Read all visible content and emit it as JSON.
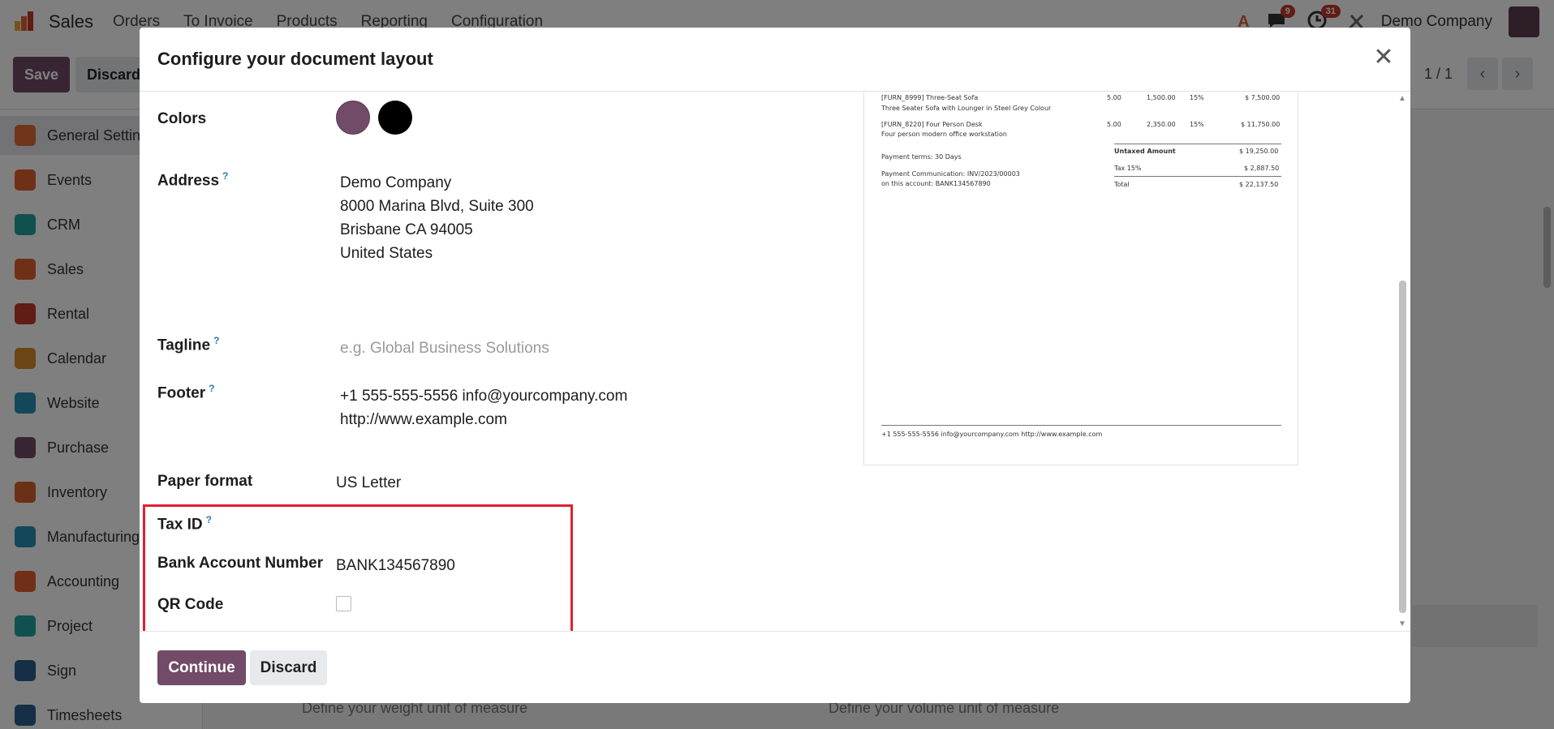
{
  "app": {
    "name": "Sales"
  },
  "topnav": [
    "Orders",
    "To Invoice",
    "Products",
    "Reporting",
    "Configuration"
  ],
  "topright": {
    "messages_count": "9",
    "activities_count": "31",
    "company": "Demo Company"
  },
  "control": {
    "save_label": "Save",
    "discard_label": "Discard",
    "pager": "1 / 1"
  },
  "sidebar": {
    "items": [
      {
        "label": "General Settings",
        "color": "#e06b35"
      },
      {
        "label": "Events",
        "color": "#e0602e"
      },
      {
        "label": "CRM",
        "color": "#20a3a0"
      },
      {
        "label": "Sales",
        "color": "#e0602e"
      },
      {
        "label": "Rental",
        "color": "#c0392b"
      },
      {
        "label": "Calendar",
        "color": "#d98a2b"
      },
      {
        "label": "Website",
        "color": "#2a8fb5"
      },
      {
        "label": "Purchase",
        "color": "#714b67"
      },
      {
        "label": "Inventory",
        "color": "#d9612e"
      },
      {
        "label": "Manufacturing",
        "color": "#2a8fb5"
      },
      {
        "label": "Accounting",
        "color": "#e0602e"
      },
      {
        "label": "Project",
        "color": "#20a3a0"
      },
      {
        "label": "Sign",
        "color": "#2a5e8f"
      },
      {
        "label": "Timesheets",
        "color": "#2a5e8f"
      }
    ]
  },
  "background_fields": {
    "weight": "Define your weight unit of measure",
    "volume": "Define your volume unit of measure"
  },
  "modal": {
    "title": "Configure your document layout",
    "fields": {
      "colors_label": "Colors",
      "colors": [
        "#714b67",
        "#000000"
      ],
      "address_label": "Address",
      "address_lines": [
        "Demo Company",
        "8000 Marina Blvd, Suite 300",
        "Brisbane CA 94005",
        "United States"
      ],
      "tagline_label": "Tagline",
      "tagline_placeholder": "e.g. Global Business Solutions",
      "footer_label": "Footer",
      "footer_lines": [
        "+1 555-555-5556 info@yourcompany.com",
        "http://www.example.com"
      ],
      "paper_format_label": "Paper format",
      "paper_format": "US Letter",
      "tax_id_label": "Tax ID",
      "bank_label": "Bank Account Number",
      "bank_value": "BANK134567890",
      "qr_label": "QR Code",
      "qr_checked": false
    },
    "preview": {
      "rows": [
        {
          "name": "[FURN_8999] Three-Seat Sofa",
          "desc": "Three Seater Sofa with Lounger in Steel Grey Colour",
          "qty": "5.00",
          "price": "1,500.00",
          "tax": "15%",
          "amount": "$ 7,500.00"
        },
        {
          "name": "[FURN_8220] Four Person Desk",
          "desc": "Four person modern office workstation",
          "qty": "5.00",
          "price": "2,350.00",
          "tax": "15%",
          "amount": "$ 11,750.00"
        }
      ],
      "payment_terms": "Payment terms: 30 Days",
      "payment_comm": "Payment Communication: INV/2023/00003",
      "payment_account": "on this account: BANK134567890",
      "untaxed_label": "Untaxed Amount",
      "untaxed_value": "$ 19,250.00",
      "tax_label": "Tax 15%",
      "tax_value": "$ 2,887.50",
      "total_label": "Total",
      "total_value": "$ 22,137.50",
      "footer_text": "+1 555-555-5556 info@yourcompany.com http://www.example.com"
    },
    "continue_label": "Continue",
    "discard_label": "Discard"
  }
}
